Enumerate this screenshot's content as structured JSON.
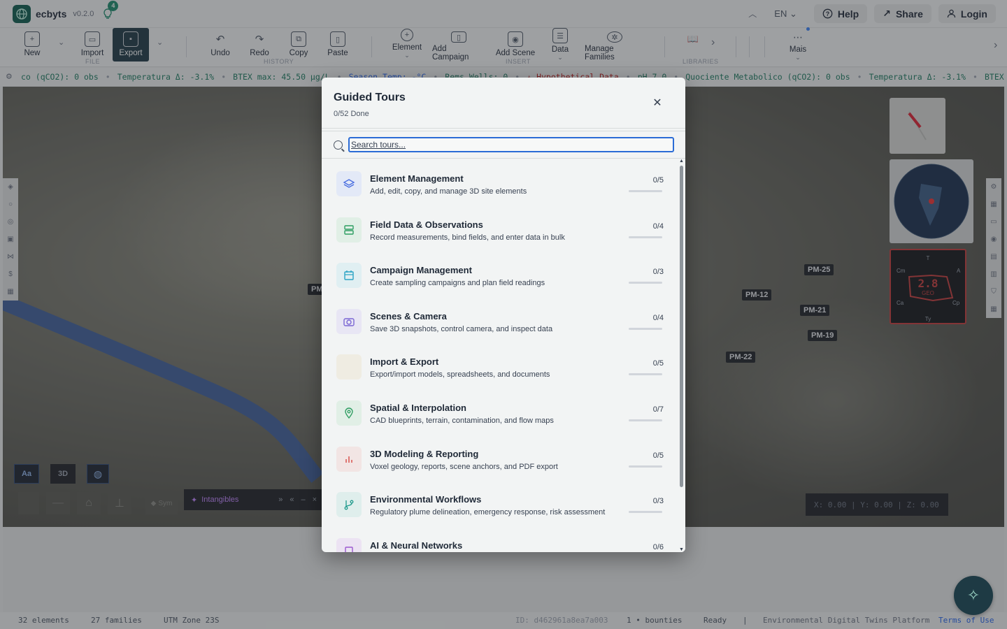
{
  "app": {
    "name": "ecbyts",
    "version": "v0.2.0",
    "tips_count": "4",
    "language": "EN"
  },
  "top_buttons": {
    "help": "Help",
    "share": "Share",
    "login": "Login"
  },
  "ribbon": {
    "new": "New",
    "import": "Import",
    "export": "Export",
    "undo": "Undo",
    "redo": "Redo",
    "copy": "Copy",
    "paste": "Paste",
    "element": "Element",
    "add_campaign": "Add Campaign",
    "add_scene": "Add Scene",
    "data": "Data",
    "manage_families": "Manage Families",
    "mais": "Mais",
    "group_file": "FILE",
    "group_history": "HISTORY",
    "group_insert": "INSERT",
    "group_libraries": "LIBRARIES"
  },
  "ticker": [
    {
      "text": "co (qCO2): 0 obs",
      "tone": "normal"
    },
    {
      "text": "Temperatura Δ: -3.1%",
      "tone": "normal"
    },
    {
      "text": "BTEX max: 45.50 µg/L",
      "tone": "normal"
    },
    {
      "text": "Season Temp: -°C",
      "tone": "blue"
    },
    {
      "text": "Rems Wells: 0",
      "tone": "normal"
    },
    {
      "text": "⚠ Hypothetical Data",
      "tone": "warn"
    },
    {
      "text": "pH 7.0",
      "tone": "normal"
    },
    {
      "text": "Quociente Metabolico (qCO2): 0 obs",
      "tone": "normal"
    },
    {
      "text": "Temperatura Δ: -3.1%",
      "tone": "normal"
    },
    {
      "text": "BTEX",
      "tone": "normal"
    }
  ],
  "wells": {
    "pm_partial": "PM",
    "pm25": "PM-25",
    "pm12": "PM-12",
    "pm21": "PM-21",
    "pm19": "PM-19",
    "pm22": "PM-22"
  },
  "radar": {
    "value": "2.8",
    "sub": "GEO",
    "t": "T",
    "a": "A",
    "cp": "Cp",
    "ty": "Ty",
    "ca": "Ca",
    "cm": "Cm"
  },
  "viewport_controls": {
    "aa": "Aa",
    "three_d": "3D",
    "sym": "Sym",
    "intangibles": "Intangibles",
    "coords": "X: 0.00 | Y: 0.00 | Z: 0.00"
  },
  "modal": {
    "title": "Guided Tours",
    "subtitle": "0/52 Done",
    "search_placeholder": "Search tours...",
    "tours": [
      {
        "name": "Element Management",
        "desc": "Add, edit, copy, and manage 3D site elements",
        "count": "0/5",
        "color": "#4a6ee0",
        "bg": "#e3e9f7",
        "icon": "layers-icon"
      },
      {
        "name": "Field Data & Observations",
        "desc": "Record measurements, bind fields, and enter data in bulk",
        "count": "0/4",
        "color": "#2f9e62",
        "bg": "#e1efe6",
        "icon": "database-icon"
      },
      {
        "name": "Campaign Management",
        "desc": "Create sampling campaigns and plan field readings",
        "count": "0/3",
        "color": "#2aa3c4",
        "bg": "#e0eff2",
        "icon": "calendar-icon"
      },
      {
        "name": "Scenes & Camera",
        "desc": "Save 3D snapshots, control camera, and inspect data",
        "count": "0/4",
        "color": "#7b67d4",
        "bg": "#e8e6f4",
        "icon": "camera-icon"
      },
      {
        "name": "Import & Export",
        "desc": "Export/import models, spreadsheets, and documents",
        "count": "0/5",
        "color": "#c9b27a",
        "bg": "#efece2",
        "icon": "blank-icon"
      },
      {
        "name": "Spatial & Interpolation",
        "desc": "CAD blueprints, terrain, contamination, and flow maps",
        "count": "0/7",
        "color": "#2f9e62",
        "bg": "#e1efe6",
        "icon": "map-pin-icon"
      },
      {
        "name": "3D Modeling & Reporting",
        "desc": "Voxel geology, reports, scene anchors, and PDF export",
        "count": "0/5",
        "color": "#d9534f",
        "bg": "#f2e5e4",
        "icon": "bar-chart-icon"
      },
      {
        "name": "Environmental Workflows",
        "desc": "Regulatory plume delineation, emergency response, risk assessment",
        "count": "0/3",
        "color": "#1f9a8c",
        "bg": "#dfeeec",
        "icon": "git-branch-icon"
      },
      {
        "name": "AI & Neural Networks",
        "desc": "",
        "count": "0/6",
        "color": "#9b59d0",
        "bg": "#ece3f3",
        "icon": "cpu-icon"
      }
    ]
  },
  "status": {
    "elements": "32 elements",
    "families": "27 families",
    "utm": "UTM Zone 23S",
    "id": "ID: d462961a8ea7a003",
    "bounties": "1 • bounties",
    "ready": "Ready",
    "platform": "Environmental Digital Twins Platform",
    "terms": "Terms of Use"
  }
}
